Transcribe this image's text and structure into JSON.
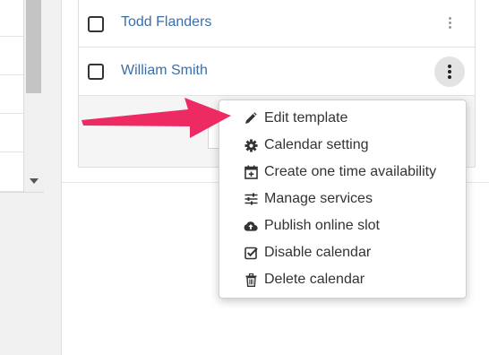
{
  "colors": {
    "arrow": "#ee2a63",
    "link": "#3a6fa8"
  },
  "list": {
    "rows": [
      {
        "name": "Todd Flanders",
        "selected": false
      },
      {
        "name": "William Smith",
        "selected": false
      }
    ]
  },
  "menu": {
    "items": [
      {
        "label": "Edit template",
        "icon": "pencil-icon"
      },
      {
        "label": "Calendar setting",
        "icon": "gear-icon"
      },
      {
        "label": "Create one time availability",
        "icon": "calendar-plus-icon"
      },
      {
        "label": "Manage services",
        "icon": "sliders-icon"
      },
      {
        "label": "Publish online slot",
        "icon": "cloud-upload-icon"
      },
      {
        "label": "Disable calendar",
        "icon": "checkbox-checked-icon"
      },
      {
        "label": "Delete calendar",
        "icon": "trash-icon"
      }
    ]
  }
}
